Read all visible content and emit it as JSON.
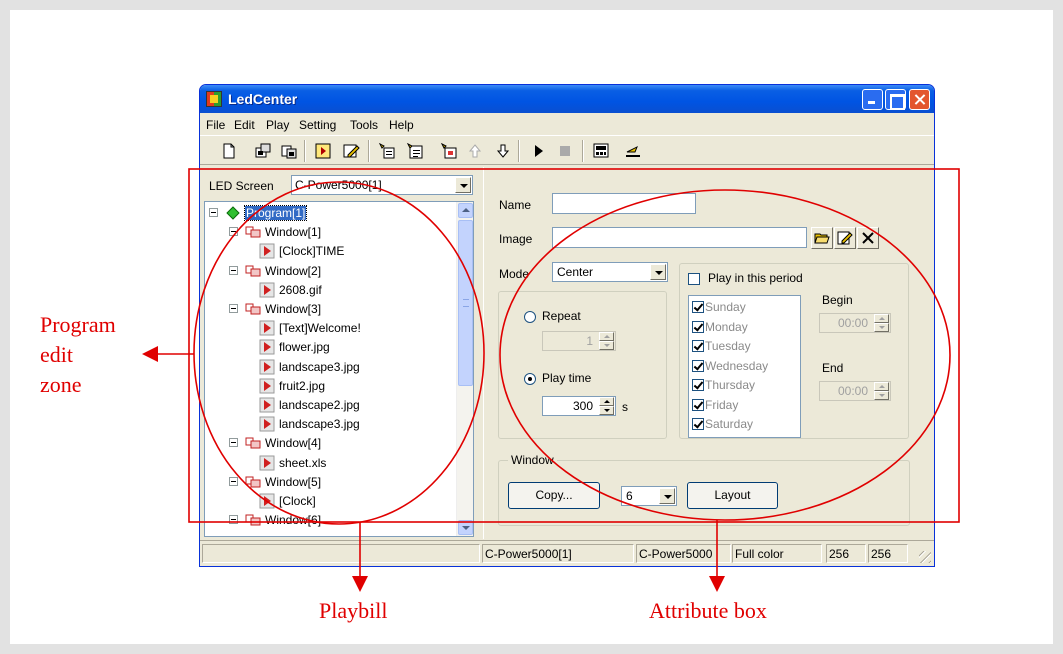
{
  "window": {
    "title": "LedCenter"
  },
  "menu": [
    "File",
    "Edit",
    "Play",
    "Setting",
    "Tools",
    "Help"
  ],
  "toolbar": {
    "icons": [
      "new-icon",
      "open-icon",
      "save-icon",
      "program-icon",
      "edit-icon",
      "add-window-icon",
      "add-item-icon",
      "add-file-icon",
      "move-up-icon",
      "move-down-icon",
      "play-icon",
      "stop-icon",
      "screen-icon",
      "send-icon"
    ]
  },
  "left": {
    "led_screen_label": "LED Screen",
    "led_screen_value": "C-Power5000[1]",
    "tree": [
      {
        "label": "Program[1]",
        "type": "program",
        "level": 0
      },
      {
        "label": "Window[1]",
        "type": "window",
        "level": 1
      },
      {
        "label": "[Clock]TIME",
        "type": "item",
        "level": 2
      },
      {
        "label": "Window[2]",
        "type": "window",
        "level": 1
      },
      {
        "label": "2608.gif",
        "type": "item",
        "level": 2
      },
      {
        "label": "Window[3]",
        "type": "window",
        "level": 1
      },
      {
        "label": "[Text]Welcome!",
        "type": "item",
        "level": 2
      },
      {
        "label": "flower.jpg",
        "type": "item",
        "level": 2
      },
      {
        "label": "landscape3.jpg",
        "type": "item",
        "level": 2
      },
      {
        "label": "fruit2.jpg",
        "type": "item",
        "level": 2
      },
      {
        "label": "landscape2.jpg",
        "type": "item",
        "level": 2
      },
      {
        "label": "landscape3.jpg",
        "type": "item",
        "level": 2
      },
      {
        "label": "Window[4]",
        "type": "window",
        "level": 1
      },
      {
        "label": "sheet.xls",
        "type": "item",
        "level": 2
      },
      {
        "label": "Window[5]",
        "type": "window",
        "level": 1
      },
      {
        "label": "[Clock]",
        "type": "item",
        "level": 2
      },
      {
        "label": "Window[6]",
        "type": "window",
        "level": 1
      }
    ]
  },
  "right": {
    "name_label": "Name",
    "name_value": "",
    "image_label": "Image",
    "image_value": "",
    "mode_label": "Mode",
    "mode_value": "Center",
    "repeat_label": "Repeat",
    "repeat_value": "1",
    "play_time_label": "Play time",
    "play_time_value": "300",
    "play_time_unit": "s",
    "period_label": "Play in this period",
    "days": [
      "Sunday",
      "Monday",
      "Tuesday",
      "Wednesday",
      "Thursday",
      "Friday",
      "Saturday"
    ],
    "begin_label": "Begin",
    "begin_value": "00:00",
    "end_label": "End",
    "end_value": "00:00",
    "window_group_label": "Window",
    "copy_button": "Copy...",
    "window_count": "6",
    "layout_button": "Layout"
  },
  "status": [
    "C-Power5000[1]",
    "C-Power5000",
    "Full color",
    "256",
    "256"
  ],
  "annotations": {
    "program_edit_zone": [
      "Program",
      "edit",
      "zone"
    ],
    "playbill": "Playbill",
    "attribute_box": "Attribute box",
    "color": "#e00000"
  }
}
